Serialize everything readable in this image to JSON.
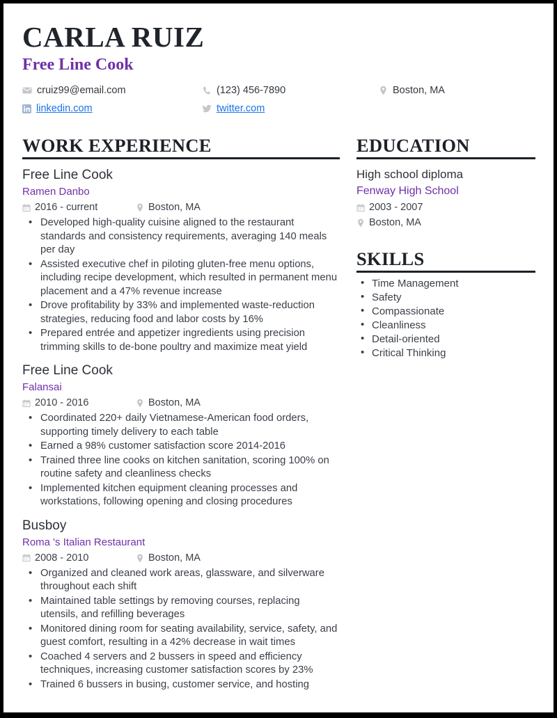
{
  "header": {
    "name": "CARLA RUIZ",
    "title": "Free Line Cook",
    "contacts": {
      "email": "cruiz99@email.com",
      "phone": "(123) 456-7890",
      "location": "Boston, MA",
      "linkedin": "linkedin.com",
      "twitter": "twitter.com"
    },
    "icons": {
      "email": "envelope-icon",
      "phone": "phone-icon",
      "location": "location-pin-icon",
      "linkedin": "linkedin-icon",
      "twitter": "twitter-icon"
    }
  },
  "colors": {
    "accent_purple": "#6f30a8",
    "link_blue": "#1a73e8",
    "heading_dark": "#1d2128",
    "body_gray": "#3a3f47",
    "icon_gray": "#c3c6cb"
  },
  "work": {
    "heading": "WORK EXPERIENCE",
    "entries": [
      {
        "title": "Free Line Cook",
        "org": "Ramen Danbo",
        "dates": "2016 - current",
        "location": "Boston, MA",
        "bullets": [
          "Developed high-quality cuisine aligned to the restaurant standards and consistency requirements, averaging 140 meals per day",
          "Assisted executive chef in piloting gluten-free menu options, including recipe development, which resulted in permanent menu placement and a 47% revenue increase",
          "Drove profitability by 33% and implemented waste-reduction strategies, reducing food and labor costs by 16%",
          "Prepared entrée and appetizer ingredients using precision trimming skills to de-bone poultry and maximize meat yield"
        ]
      },
      {
        "title": "Free Line Cook",
        "org": "Falansai",
        "dates": "2010 - 2016",
        "location": "Boston, MA",
        "bullets": [
          "Coordinated 220+ daily Vietnamese-American food orders, supporting timely delivery to each table",
          "Earned a 98% customer satisfaction score 2014-2016",
          "Trained three line cooks on kitchen sanitation, scoring 100% on routine safety and cleanliness checks",
          "Implemented kitchen equipment cleaning processes and workstations, following opening and closing procedures"
        ]
      },
      {
        "title": "Busboy",
        "org": "Roma 's Italian Restaurant",
        "dates": "2008 - 2010",
        "location": "Boston, MA",
        "bullets": [
          "Organized and cleaned work areas, glassware, and silverware throughout each shift",
          "Maintained table settings by removing courses, replacing utensils, and refilling beverages",
          "Monitored dining room for seating availability, service, safety, and guest comfort, resulting in a 42% decrease in wait times",
          "Coached 4 servers and 2 bussers in speed and efficiency techniques, increasing customer satisfaction scores by 23%",
          "Trained 6 bussers in busing, customer service, and hosting"
        ]
      }
    ]
  },
  "education": {
    "heading": "EDUCATION",
    "degree": "High school diploma",
    "school": "Fenway High School",
    "dates": "2003 - 2007",
    "location": "Boston, MA"
  },
  "skills": {
    "heading": "SKILLS",
    "items": [
      "Time Management",
      "Safety",
      "Compassionate",
      "Cleanliness",
      "Detail-oriented",
      "Critical Thinking"
    ]
  }
}
